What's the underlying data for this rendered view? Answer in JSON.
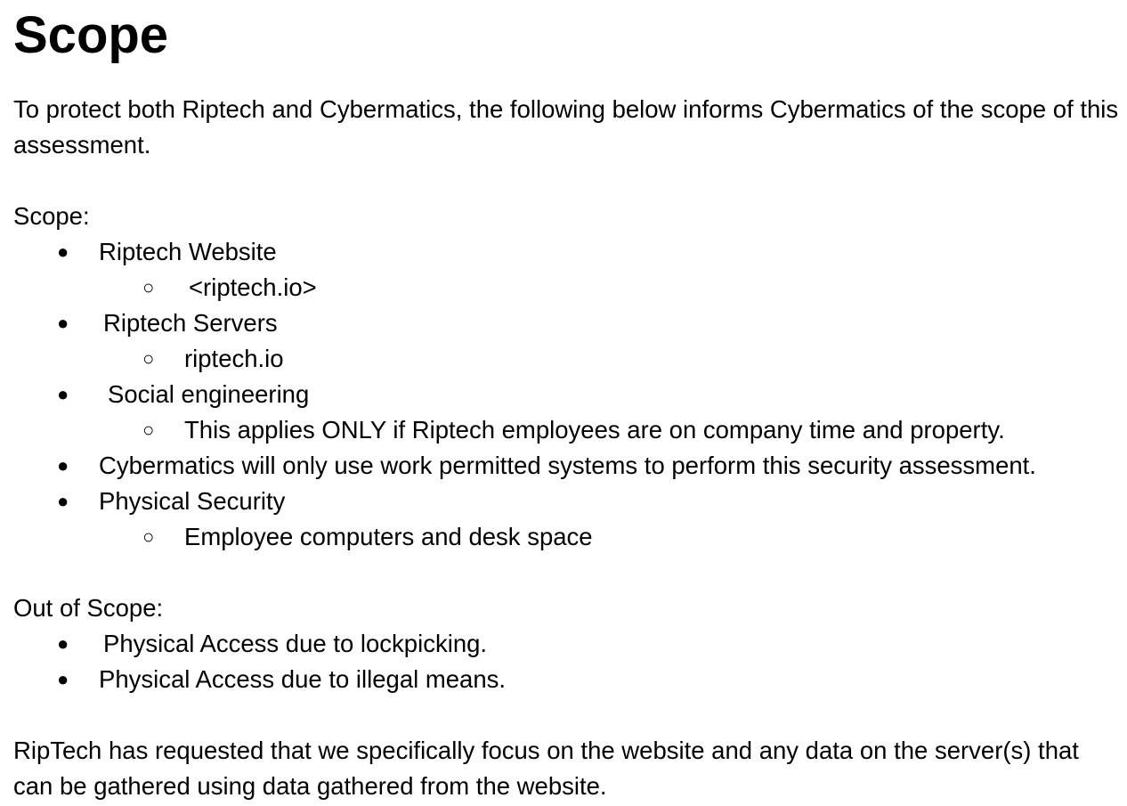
{
  "title": "Scope",
  "intro": "To protect both Riptech and Cybermatics, the following below informs Cybermatics of the scope of this assessment.",
  "in_scope": {
    "heading": "Scope:",
    "items": [
      {
        "label": "Riptech Website",
        "sub": "<riptech.io>"
      },
      {
        "label": "Riptech Servers",
        "sub": "riptech.io"
      },
      {
        "label": "Social engineering",
        "sub": "This applies ONLY if Riptech employees are on company time and property."
      },
      {
        "label": "Cybermatics will only use work permitted systems to perform this security assessment."
      },
      {
        "label": "Physical Security",
        "sub": "Employee computers and desk space"
      }
    ]
  },
  "out_of_scope": {
    "heading": "Out of Scope:",
    "items": [
      {
        "label": "Physical Access due to lockpicking."
      },
      {
        "label": "Physical Access due to illegal means."
      }
    ]
  },
  "closing": "RipTech has requested that we specifically focus on the website and any data on the server(s) that can be gathered using data gathered from the website.",
  "bullet_glyph": "●",
  "subbullet_glyph": "○"
}
